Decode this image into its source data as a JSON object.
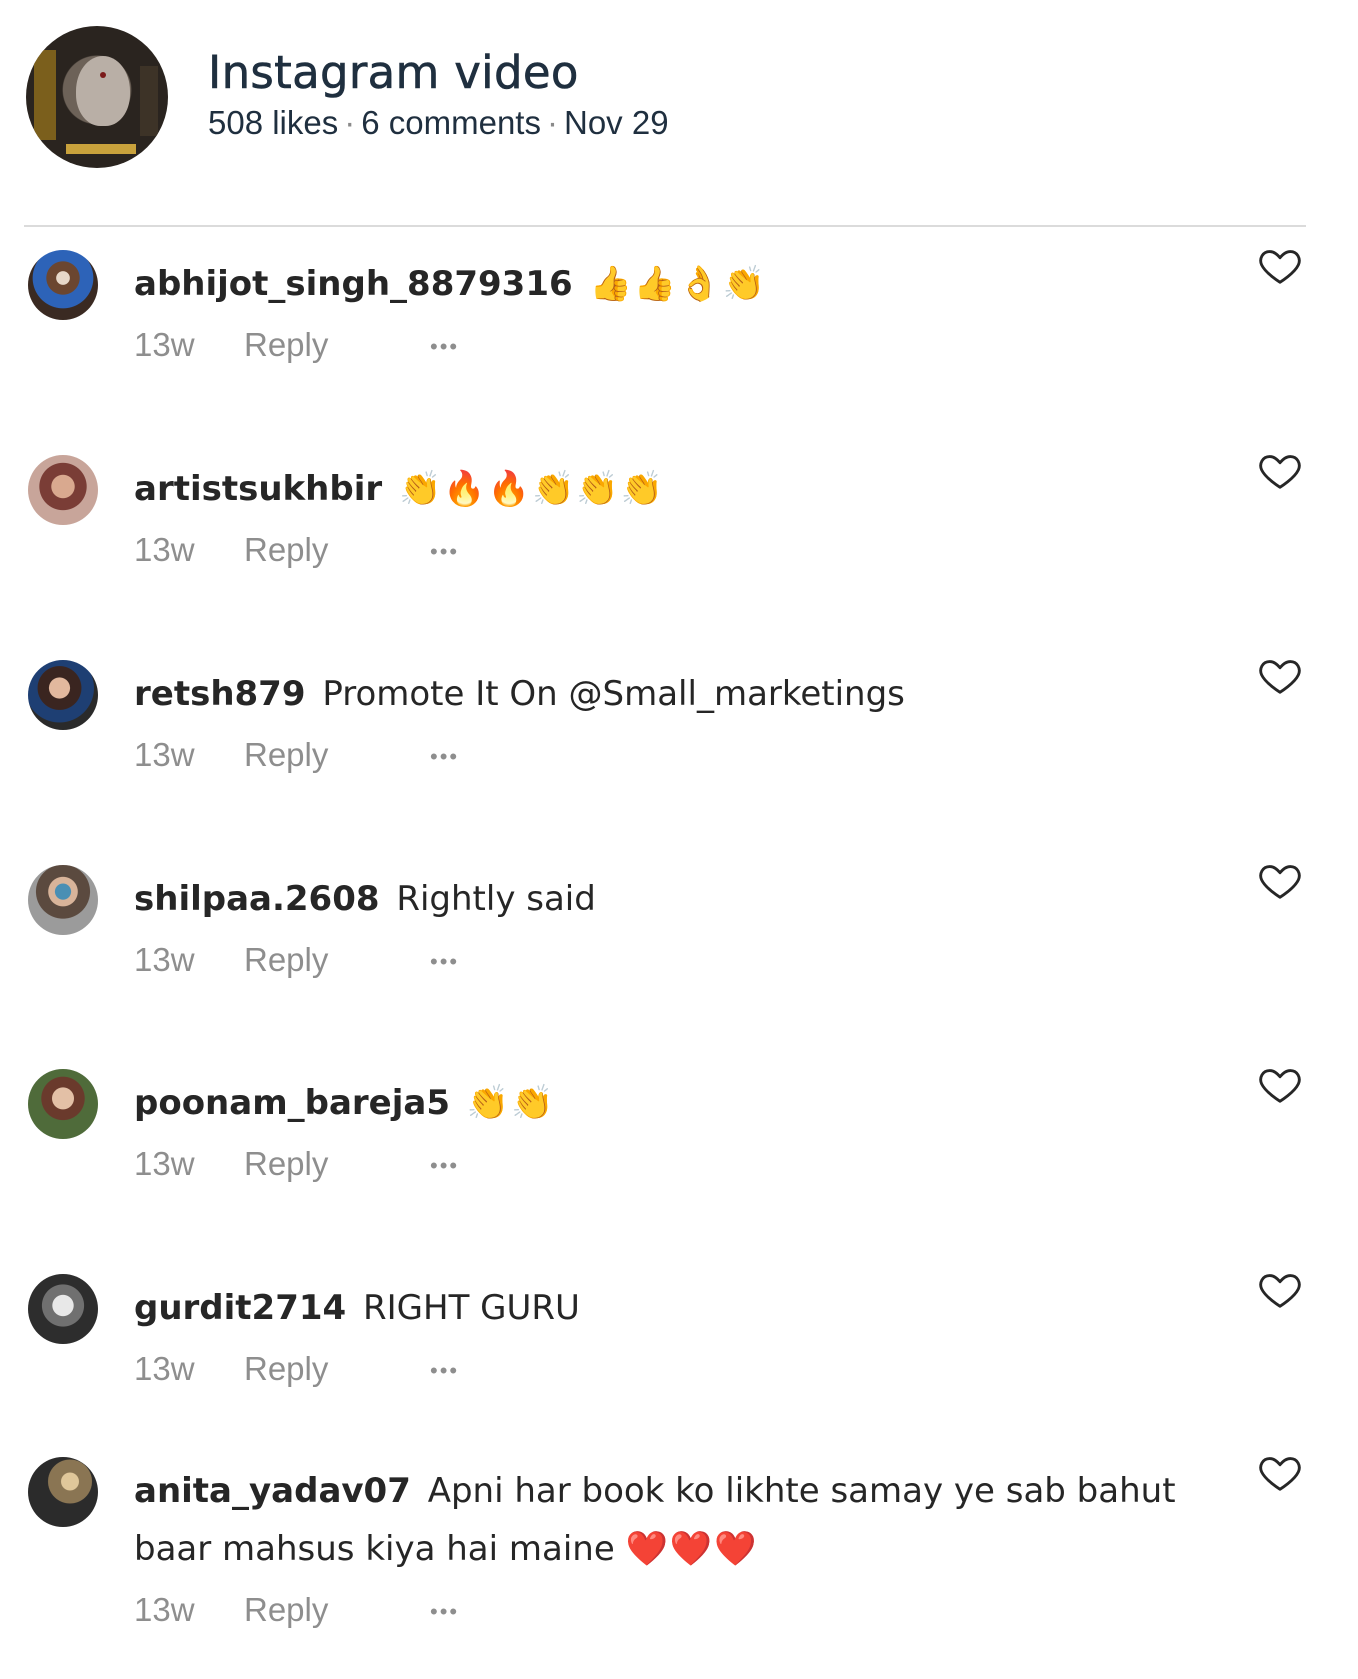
{
  "post": {
    "title": "Instagram video",
    "likes": "508 likes",
    "comments_count": "6 comments",
    "date": "Nov 29",
    "separator": "·"
  },
  "comments": [
    {
      "username": "abhijot_singh_8879316",
      "text": "",
      "emoji": "👍👍👌👏",
      "time": "13w",
      "reply": "Reply",
      "more": "•••"
    },
    {
      "username": "artistsukhbir",
      "text": "",
      "emoji": "👏🔥🔥👏👏👏",
      "time": "13w",
      "reply": "Reply",
      "more": "•••"
    },
    {
      "username": "retsh879",
      "text": "Promote It On @Small_marketings",
      "emoji": "",
      "time": "13w",
      "reply": "Reply",
      "more": "•••"
    },
    {
      "username": "shilpaa.2608",
      "text": "Rightly said",
      "emoji": "",
      "time": "13w",
      "reply": "Reply",
      "more": "•••"
    },
    {
      "username": "poonam_bareja5",
      "text": "",
      "emoji": "👏👏",
      "time": "13w",
      "reply": "Reply",
      "more": "•••"
    },
    {
      "username": "gurdit2714",
      "text": "RIGHT GURU",
      "emoji": "",
      "time": "13w",
      "reply": "Reply",
      "more": "•••"
    },
    {
      "username": "anita_yadav07",
      "text": "Apni har book ko likhte samay ye sab bahut baar mahsus kiya hai maine",
      "emoji": "❤️❤️❤️",
      "time": "13w",
      "reply": "Reply",
      "more": "•••"
    }
  ],
  "icons": {
    "like": "heart-outline-icon",
    "more": "more-options-icon"
  },
  "colors": {
    "title": "#1f2f3f",
    "text": "#262626",
    "muted": "#8e8e8e",
    "divider": "#dbdbdb"
  }
}
